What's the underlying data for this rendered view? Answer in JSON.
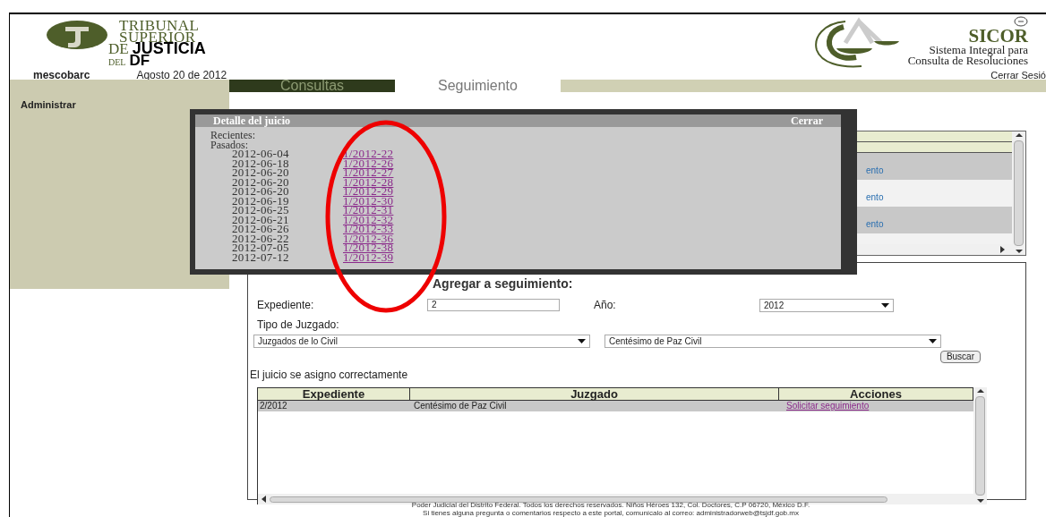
{
  "header": {
    "logo_left": {
      "lines": [
        "TRIBUNAL",
        "SUPERIOR"
      ],
      "de": "DE",
      "justicia": "JUSTICIA",
      "del": "DEL",
      "df": "DF"
    },
    "logo_right": {
      "title": "SICOR",
      "subtitle_1": "Sistema Integral para",
      "subtitle_2": "Consulta de Resoluciones"
    },
    "user": "mescobarc",
    "date": "Agosto 20 de 2012",
    "logout": "Cerrar Sesió"
  },
  "tabs": [
    {
      "label": "Consultas",
      "selected": false
    },
    {
      "label": "Seguimiento",
      "selected": true
    }
  ],
  "sidebar": {
    "items": [
      {
        "label": "Administrar"
      }
    ]
  },
  "upper_table": {
    "rows": [
      {
        "action": "ento",
        "shade": true
      },
      {
        "action": "ento",
        "shade": false
      },
      {
        "action": "ento",
        "shade": true
      }
    ]
  },
  "modal": {
    "title": "Detalle del juicio",
    "close": "Cerrar",
    "recent_label": "Recientes:",
    "past_label": "Pasados:",
    "items": [
      {
        "date": "2012-06-04",
        "case": "1/2012-22"
      },
      {
        "date": "2012-06-18",
        "case": "1/2012-26"
      },
      {
        "date": "2012-06-20",
        "case": "1/2012-27"
      },
      {
        "date": "2012-06-20",
        "case": "1/2012-28"
      },
      {
        "date": "2012-06-20",
        "case": "1/2012-29"
      },
      {
        "date": "2012-06-19",
        "case": "1/2012-30"
      },
      {
        "date": "2012-06-25",
        "case": "1/2012-31"
      },
      {
        "date": "2012-06-21",
        "case": "1/2012-32"
      },
      {
        "date": "2012-06-26",
        "case": "1/2012-33"
      },
      {
        "date": "2012-06-22",
        "case": "1/2012-36"
      },
      {
        "date": "2012-07-05",
        "case": "1/2012-38"
      },
      {
        "date": "2012-07-12",
        "case": "1/2012-39"
      }
    ]
  },
  "form": {
    "title": "Agregar a seguimiento:",
    "expediente_label": "Expediente:",
    "expediente_value": "2",
    "year_label": "Año:",
    "year_value": "2012",
    "court_type_label": "Tipo de Juzgado:",
    "court_type_value": "Juzgados de lo Civil",
    "court_value": "Centésimo de Paz Civil",
    "search_button": "Buscar",
    "message": "El juicio se asigno correctamente"
  },
  "table": {
    "columns": [
      "Expediente",
      "Juzgado",
      "Acciones"
    ],
    "rows": [
      {
        "expediente": "2/2012",
        "juzgado": "Centésimo de Paz Civil",
        "accion": "Solicitar seguimiento"
      }
    ]
  },
  "footer": [
    "Poder Judicial del Distrito Federal. Todos los derechos reservados. Niños Héroes 132, Col. Doctores, C.P 06720, México D.F.",
    "Si tienes alguna pregunta o comentarios respecto a este portal, comunícalo al correo: administradorweb@tsjdf.gob.mx"
  ]
}
